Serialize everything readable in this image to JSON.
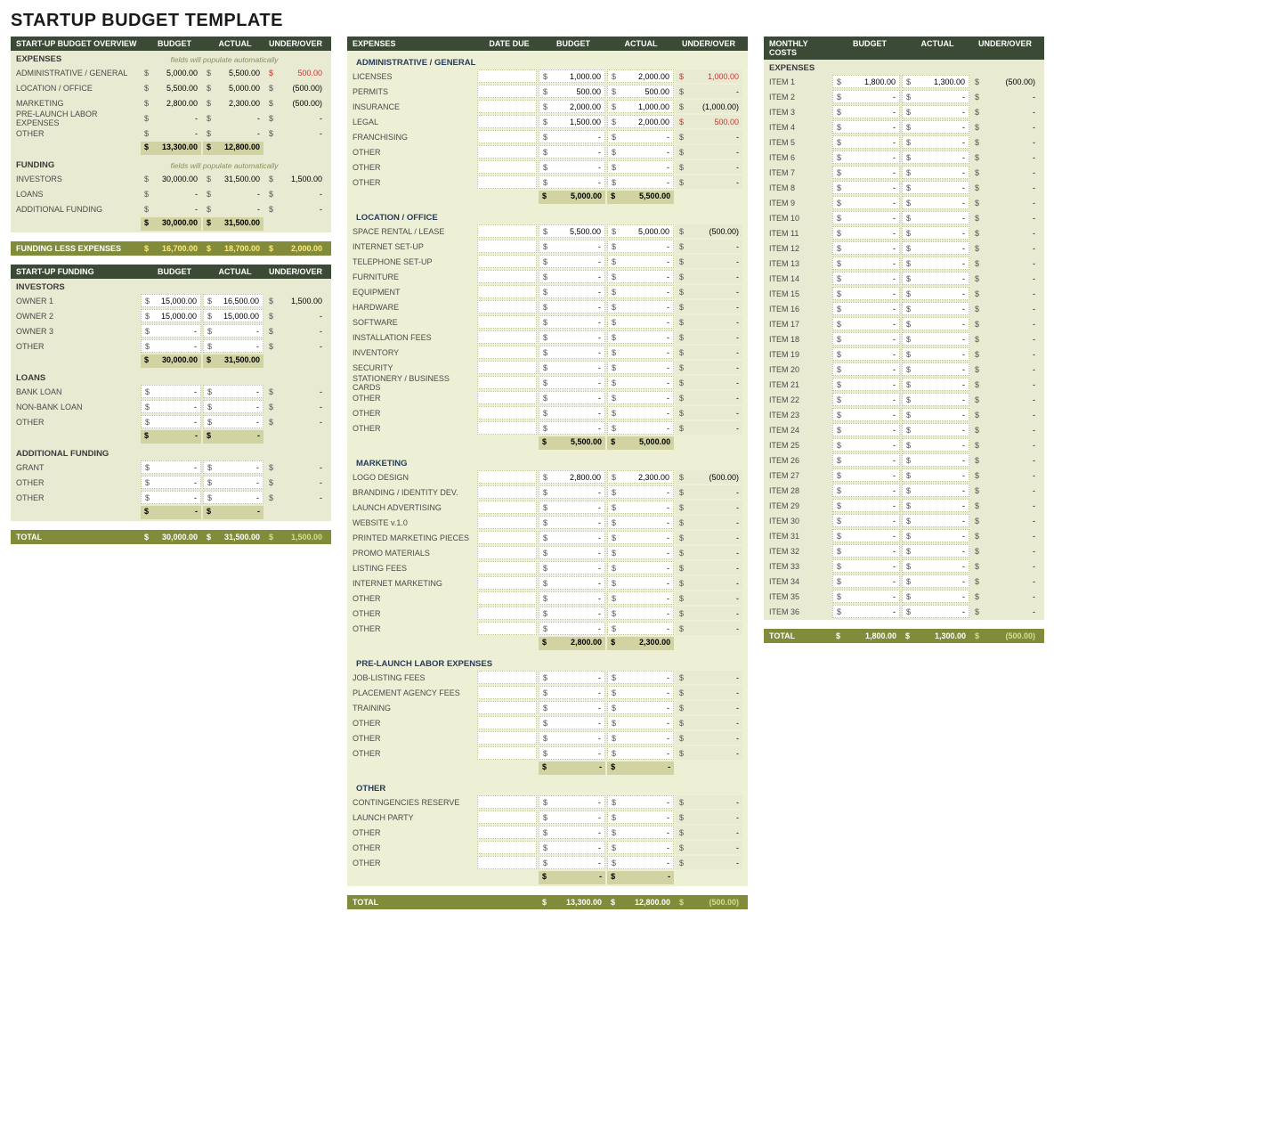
{
  "title": "STARTUP BUDGET TEMPLATE",
  "hcols": {
    "budget": "BUDGET",
    "actual": "ACTUAL",
    "uo": "UNDER/OVER",
    "due": "DATE DUE"
  },
  "sym": {
    "dollar": "$",
    "dash": "-"
  },
  "autoNote": "fields will populate automatically",
  "p1": {
    "header": "START-UP BUDGET OVERVIEW",
    "expenses": {
      "label": "EXPENSES",
      "rows": [
        {
          "label": "ADMINISTRATIVE / GENERAL",
          "b": "5,000.00",
          "a": "5,500.00",
          "u": "500.00",
          "neg": true
        },
        {
          "label": "LOCATION / OFFICE",
          "b": "5,500.00",
          "a": "5,000.00",
          "u": "(500.00)"
        },
        {
          "label": "MARKETING",
          "b": "2,800.00",
          "a": "2,300.00",
          "u": "(500.00)"
        },
        {
          "label": "PRE-LAUNCH LABOR EXPENSES",
          "b": "-",
          "a": "-",
          "u": "-"
        },
        {
          "label": "OTHER",
          "b": "-",
          "a": "-",
          "u": "-"
        }
      ],
      "sub": {
        "b": "13,300.00",
        "a": "12,800.00"
      }
    },
    "funding": {
      "label": "FUNDING",
      "rows": [
        {
          "label": "INVESTORS",
          "b": "30,000.00",
          "a": "31,500.00",
          "u": "1,500.00"
        },
        {
          "label": "LOANS",
          "b": "-",
          "a": "-",
          "u": "-"
        },
        {
          "label": "ADDITIONAL FUNDING",
          "b": "-",
          "a": "-",
          "u": "-"
        }
      ],
      "sub": {
        "b": "30,000.00",
        "a": "31,500.00"
      }
    },
    "less": {
      "label": "FUNDING LESS EXPENSES",
      "b": "16,700.00",
      "a": "18,700.00",
      "u": "2,000.00"
    },
    "funding2": {
      "header": "START-UP FUNDING",
      "groups": [
        {
          "label": "INVESTORS",
          "rows": [
            {
              "label": "OWNER 1",
              "b": "15,000.00",
              "a": "16,500.00",
              "u": "1,500.00"
            },
            {
              "label": "OWNER 2",
              "b": "15,000.00",
              "a": "15,000.00",
              "u": "-"
            },
            {
              "label": "OWNER 3",
              "b": "-",
              "a": "-",
              "u": "-"
            },
            {
              "label": "OTHER",
              "b": "-",
              "a": "-",
              "u": "-"
            }
          ],
          "sub": {
            "b": "30,000.00",
            "a": "31,500.00"
          }
        },
        {
          "label": "LOANS",
          "rows": [
            {
              "label": "BANK LOAN",
              "b": "-",
              "a": "-",
              "u": "-"
            },
            {
              "label": "NON-BANK LOAN",
              "b": "-",
              "a": "-",
              "u": "-"
            },
            {
              "label": "OTHER",
              "b": "-",
              "a": "-",
              "u": "-"
            }
          ],
          "sub": {
            "b": "-",
            "a": "-"
          }
        },
        {
          "label": "ADDITIONAL FUNDING",
          "rows": [
            {
              "label": "GRANT",
              "b": "-",
              "a": "-",
              "u": "-"
            },
            {
              "label": "OTHER",
              "b": "-",
              "a": "-",
              "u": "-"
            },
            {
              "label": "OTHER",
              "b": "-",
              "a": "-",
              "u": "-"
            }
          ],
          "sub": {
            "b": "-",
            "a": "-"
          }
        }
      ],
      "total": {
        "label": "TOTAL",
        "b": "30,000.00",
        "a": "31,500.00",
        "u": "1,500.00"
      }
    }
  },
  "p2": {
    "header": "EXPENSES",
    "groups": [
      {
        "label": "ADMINISTRATIVE / GENERAL",
        "rows": [
          {
            "label": "LICENSES",
            "b": "1,000.00",
            "a": "2,000.00",
            "u": "1,000.00",
            "neg": true
          },
          {
            "label": "PERMITS",
            "b": "500.00",
            "a": "500.00",
            "u": "-"
          },
          {
            "label": "INSURANCE",
            "b": "2,000.00",
            "a": "1,000.00",
            "u": "(1,000.00)"
          },
          {
            "label": "LEGAL",
            "b": "1,500.00",
            "a": "2,000.00",
            "u": "500.00",
            "neg": true
          },
          {
            "label": "FRANCHISING",
            "b": "-",
            "a": "-",
            "u": "-"
          },
          {
            "label": "OTHER",
            "b": "-",
            "a": "-",
            "u": "-"
          },
          {
            "label": "OTHER",
            "b": "-",
            "a": "-",
            "u": "-"
          },
          {
            "label": "OTHER",
            "b": "-",
            "a": "-",
            "u": "-"
          }
        ],
        "sub": {
          "b": "5,000.00",
          "a": "5,500.00"
        }
      },
      {
        "label": "LOCATION / OFFICE",
        "rows": [
          {
            "label": "SPACE RENTAL / LEASE",
            "b": "5,500.00",
            "a": "5,000.00",
            "u": "(500.00)"
          },
          {
            "label": "INTERNET SET-UP",
            "b": "-",
            "a": "-",
            "u": "-"
          },
          {
            "label": "TELEPHONE SET-UP",
            "b": "-",
            "a": "-",
            "u": "-"
          },
          {
            "label": "FURNITURE",
            "b": "-",
            "a": "-",
            "u": "-"
          },
          {
            "label": "EQUIPMENT",
            "b": "-",
            "a": "-",
            "u": "-"
          },
          {
            "label": "HARDWARE",
            "b": "-",
            "a": "-",
            "u": "-"
          },
          {
            "label": "SOFTWARE",
            "b": "-",
            "a": "-",
            "u": "-"
          },
          {
            "label": "INSTALLATION FEES",
            "b": "-",
            "a": "-",
            "u": "-"
          },
          {
            "label": "INVENTORY",
            "b": "-",
            "a": "-",
            "u": "-"
          },
          {
            "label": "SECURITY",
            "b": "-",
            "a": "-",
            "u": "-"
          },
          {
            "label": "STATIONERY / BUSINESS CARDS",
            "b": "-",
            "a": "-",
            "u": "-"
          },
          {
            "label": "OTHER",
            "b": "-",
            "a": "-",
            "u": "-"
          },
          {
            "label": "OTHER",
            "b": "-",
            "a": "-",
            "u": "-"
          },
          {
            "label": "OTHER",
            "b": "-",
            "a": "-",
            "u": "-"
          }
        ],
        "sub": {
          "b": "5,500.00",
          "a": "5,000.00"
        }
      },
      {
        "label": "MARKETING",
        "rows": [
          {
            "label": "LOGO DESIGN",
            "b": "2,800.00",
            "a": "2,300.00",
            "u": "(500.00)"
          },
          {
            "label": "BRANDING / IDENTITY DEV.",
            "b": "-",
            "a": "-",
            "u": "-"
          },
          {
            "label": "LAUNCH ADVERTISING",
            "b": "-",
            "a": "-",
            "u": "-"
          },
          {
            "label": "WEBSITE v.1.0",
            "b": "-",
            "a": "-",
            "u": "-"
          },
          {
            "label": "PRINTED MARKETING PIECES",
            "b": "-",
            "a": "-",
            "u": "-"
          },
          {
            "label": "PROMO MATERIALS",
            "b": "-",
            "a": "-",
            "u": "-"
          },
          {
            "label": "LISTING FEES",
            "b": "-",
            "a": "-",
            "u": "-"
          },
          {
            "label": "INTERNET MARKETING",
            "b": "-",
            "a": "-",
            "u": "-"
          },
          {
            "label": "OTHER",
            "b": "-",
            "a": "-",
            "u": "-"
          },
          {
            "label": "OTHER",
            "b": "-",
            "a": "-",
            "u": "-"
          },
          {
            "label": "OTHER",
            "b": "-",
            "a": "-",
            "u": "-"
          }
        ],
        "sub": {
          "b": "2,800.00",
          "a": "2,300.00"
        }
      },
      {
        "label": "PRE-LAUNCH LABOR EXPENSES",
        "rows": [
          {
            "label": "JOB-LISTING FEES",
            "b": "-",
            "a": "-",
            "u": "-"
          },
          {
            "label": "PLACEMENT AGENCY FEES",
            "b": "-",
            "a": "-",
            "u": "-"
          },
          {
            "label": "TRAINING",
            "b": "-",
            "a": "-",
            "u": "-"
          },
          {
            "label": "OTHER",
            "b": "-",
            "a": "-",
            "u": "-"
          },
          {
            "label": "OTHER",
            "b": "-",
            "a": "-",
            "u": "-"
          },
          {
            "label": "OTHER",
            "b": "-",
            "a": "-",
            "u": "-"
          }
        ],
        "sub": {
          "b": "-",
          "a": "-"
        }
      },
      {
        "label": "OTHER",
        "rows": [
          {
            "label": "CONTINGENCIES RESERVE",
            "b": "-",
            "a": "-",
            "u": "-"
          },
          {
            "label": "LAUNCH PARTY",
            "b": "-",
            "a": "-",
            "u": "-"
          },
          {
            "label": "OTHER",
            "b": "-",
            "a": "-",
            "u": "-"
          },
          {
            "label": "OTHER",
            "b": "-",
            "a": "-",
            "u": "-"
          },
          {
            "label": "OTHER",
            "b": "-",
            "a": "-",
            "u": "-"
          }
        ],
        "sub": {
          "b": "-",
          "a": "-"
        }
      }
    ],
    "total": {
      "label": "TOTAL",
      "b": "13,300.00",
      "a": "12,800.00",
      "u": "(500.00)"
    }
  },
  "p3": {
    "header": "MONTHLY COSTS",
    "label": "EXPENSES",
    "rows": [
      {
        "label": "ITEM 1",
        "b": "1,800.00",
        "a": "1,300.00",
        "u": "(500.00)"
      },
      {
        "label": "ITEM 2",
        "b": "-",
        "a": "-",
        "u": "-"
      },
      {
        "label": "ITEM 3",
        "b": "-",
        "a": "-",
        "u": "-"
      },
      {
        "label": "ITEM 4",
        "b": "-",
        "a": "-",
        "u": "-"
      },
      {
        "label": "ITEM 5",
        "b": "-",
        "a": "-",
        "u": "-"
      },
      {
        "label": "ITEM 6",
        "b": "-",
        "a": "-",
        "u": "-"
      },
      {
        "label": "ITEM 7",
        "b": "-",
        "a": "-",
        "u": "-"
      },
      {
        "label": "ITEM 8",
        "b": "-",
        "a": "-",
        "u": "-"
      },
      {
        "label": "ITEM 9",
        "b": "-",
        "a": "-",
        "u": "-"
      },
      {
        "label": "ITEM 10",
        "b": "-",
        "a": "-",
        "u": "-"
      },
      {
        "label": "ITEM 11",
        "b": "-",
        "a": "-",
        "u": "-"
      },
      {
        "label": "ITEM 12",
        "b": "-",
        "a": "-",
        "u": "-"
      },
      {
        "label": "ITEM 13",
        "b": "-",
        "a": "-",
        "u": "-"
      },
      {
        "label": "ITEM 14",
        "b": "-",
        "a": "-",
        "u": "-"
      },
      {
        "label": "ITEM 15",
        "b": "-",
        "a": "-",
        "u": "-"
      },
      {
        "label": "ITEM 16",
        "b": "-",
        "a": "-",
        "u": "-"
      },
      {
        "label": "ITEM 17",
        "b": "-",
        "a": "-",
        "u": "-"
      },
      {
        "label": "ITEM 18",
        "b": "-",
        "a": "-",
        "u": "-"
      },
      {
        "label": "ITEM 19",
        "b": "-",
        "a": "-",
        "u": "-"
      },
      {
        "label": "ITEM 20",
        "b": "-",
        "a": "-",
        "u": "-"
      },
      {
        "label": "ITEM 21",
        "b": "-",
        "a": "-",
        "u": "-"
      },
      {
        "label": "ITEM 22",
        "b": "-",
        "a": "-",
        "u": "-"
      },
      {
        "label": "ITEM 23",
        "b": "-",
        "a": "-",
        "u": "-"
      },
      {
        "label": "ITEM 24",
        "b": "-",
        "a": "-",
        "u": "-"
      },
      {
        "label": "ITEM 25",
        "b": "-",
        "a": "-",
        "u": "-"
      },
      {
        "label": "ITEM 26",
        "b": "-",
        "a": "-",
        "u": "-"
      },
      {
        "label": "ITEM 27",
        "b": "-",
        "a": "-",
        "u": "-"
      },
      {
        "label": "ITEM 28",
        "b": "-",
        "a": "-",
        "u": "-"
      },
      {
        "label": "ITEM 29",
        "b": "-",
        "a": "-",
        "u": "-"
      },
      {
        "label": "ITEM 30",
        "b": "-",
        "a": "-",
        "u": "-"
      },
      {
        "label": "ITEM 31",
        "b": "-",
        "a": "-",
        "u": "-"
      },
      {
        "label": "ITEM 32",
        "b": "-",
        "a": "-",
        "u": "-"
      },
      {
        "label": "ITEM 33",
        "b": "-",
        "a": "-",
        "u": "-"
      },
      {
        "label": "ITEM 34",
        "b": "-",
        "a": "-",
        "u": "-"
      },
      {
        "label": "ITEM 35",
        "b": "-",
        "a": "-",
        "u": "-"
      },
      {
        "label": "ITEM 36",
        "b": "-",
        "a": "-",
        "u": "-"
      }
    ],
    "total": {
      "label": "TOTAL",
      "b": "1,800.00",
      "a": "1,300.00",
      "u": "(500.00)"
    }
  }
}
